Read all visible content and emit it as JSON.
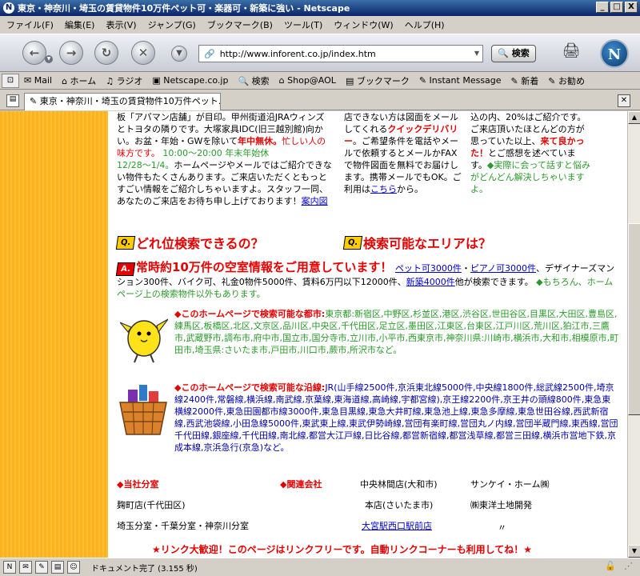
{
  "window": {
    "title": "東京・神奈川・埼玉の賃貸物件10万件ペット可・楽器可・新築に強い - Netscape",
    "minimize": "_",
    "maximize": "□",
    "close": "X"
  },
  "menu": [
    "ファイル(F)",
    "編集(E)",
    "表示(V)",
    "ジャンプ(G)",
    "ブックマーク(B)",
    "ツール(T)",
    "ウィンドウ(W)",
    "ヘルプ(H)"
  ],
  "nav": {
    "url": "http://www.inforent.co.jp/index.htm",
    "search_label": "検索"
  },
  "personal_toolbar": [
    "Mail",
    "ホーム",
    "ラジオ",
    "Netscape.co.jp",
    "検索",
    "Shop@AOL",
    "ブックマーク",
    "Instant Message",
    "新着",
    "お勧め"
  ],
  "tab": {
    "title": "東京・神奈川・埼玉の賃貸物件10万件ペット..."
  },
  "col1": {
    "t1": "板「アパマン店舗」が目印。甲州街道沿JRAウィンズとトヨタの隣りです。大塚家具IDC(旧三越別館)向かい。お盆・年始・GWを除いて",
    "t2": "年中無休。",
    "t3": "忙しい人の味方です。",
    "t4": "10:00～20:00 年末年始休",
    "t5": "12/28～1/4。",
    "t6": "ホームページやメールではご紹介できない物件もたくさんあります。ご来店いただくともっとすごい情報をご紹介しちゃいますよ。スタッフ一同、あなたのご来店をお待ち申し上げております！",
    "link": "案内図"
  },
  "col2": {
    "t1": "店できない方は図面をメールしてくれる",
    "t2": "クイックデリバリー",
    "t3": "。ご希望条件を電話やメールで依頼するとメールかFAXで物件図面を無料でお届けします。携帯メールでもOK。ご利用は",
    "link": "こちら",
    "t4": "から。"
  },
  "col3": {
    "t1": "込の内、20%はご紹介です。ご来店頂いたほとんどの方が思っていた以上、",
    "t2": "来て良かった！",
    "t3": "とご感想を述べています。",
    "t4": "◆実際に会って話すと悩みがどんどん解決しちゃいますよ。"
  },
  "questions": {
    "q_badge": "Q.",
    "q1": "どれ位検索できるの？",
    "q2": "検索可能なエリアは？",
    "a_badge": "A."
  },
  "answer": {
    "headline": "常時約10万件の空室情報をご用意しています！",
    "link1": "ペット可3000件",
    "sep": "・",
    "link2": "ピアノ可3000件",
    "t1": "、デザイナーズマンション300件、バイク可、礼金0物件5000件、賃料6万円以下12000件、",
    "link3": "新築4000件",
    "t2": "他が検索できます。",
    "t3": "◆もちろん、ホームページ上の検索物件以外もあります。"
  },
  "cities": {
    "heading": "◆このホームページで検索可能な都市:",
    "text": "東京都:新宿区,中野区,杉並区,港区,渋谷区,世田谷区,目黒区,大田区,豊島区,練馬区,板橋区,北区,文京区,品川区,中央区,千代田区,足立区,墨田区,江東区,台東区,江戸川区,荒川区,狛江市,三鷹市,武蔵野市,調布市,府中市,国立市,国分寺市,立川市,小平市,西東京市,神奈川県:川崎市,横浜市,大和市,相模原市,町田市,埼玉県:さいたま市,戸田市,川口市,蕨市,所沢市など。"
  },
  "lines": {
    "heading": "◆このホームページで検索可能な沿線:",
    "text": "JR(山手線2500件,京浜東北線5000件,中央線1800件,総武線2500件,埼京線2400件,常磐線,横浜線,南武線,京葉線,東海道線,高崎線,宇都宮線),京王線2200件,京王井の頭線800件,東急東横線2000件,東急田園都市線3000件,東急目黒線,東急大井町線,東急池上線,東急多摩線,東急世田谷線,西武新宿線,西武池袋線,小田急線5000件,東武東上線,東武伊勢崎線,営団有楽町線,営団丸ノ内線,営団半蔵門線,東西線,営団千代田線,銀座線,千代田線,南北線,都営大江戸線,日比谷線,都営新宿線,都営浅草線,都営三田線,横浜市営地下鉄,京成本線,京浜急行(京急)など。"
  },
  "branches": {
    "h1": "◆当社分室",
    "h2": "◆関連会社",
    "b1": "麹町店(千代田区)",
    "b2": "埼玉分室・千葉分室・神奈川分室",
    "r1": "中央林間店(大和市)",
    "r2": "本店(さいたま市)",
    "r3": "大宮駅西口駅前店",
    "r4": "〃",
    "g1": "サンケイ・ホーム㈱",
    "g2": "㈱東洋土地開発"
  },
  "footer": "★リンク大歓迎！このページはリンクフリーです。自動リンクコーナーも利用してね！★",
  "status": {
    "text": "ドキュメント完了 (3.155 秒)"
  },
  "colors": {
    "accent_red": "#e60000",
    "green": "#2a9a2a",
    "orange_sidebar": "#ffb21c",
    "link_blue": "#0000cc"
  }
}
